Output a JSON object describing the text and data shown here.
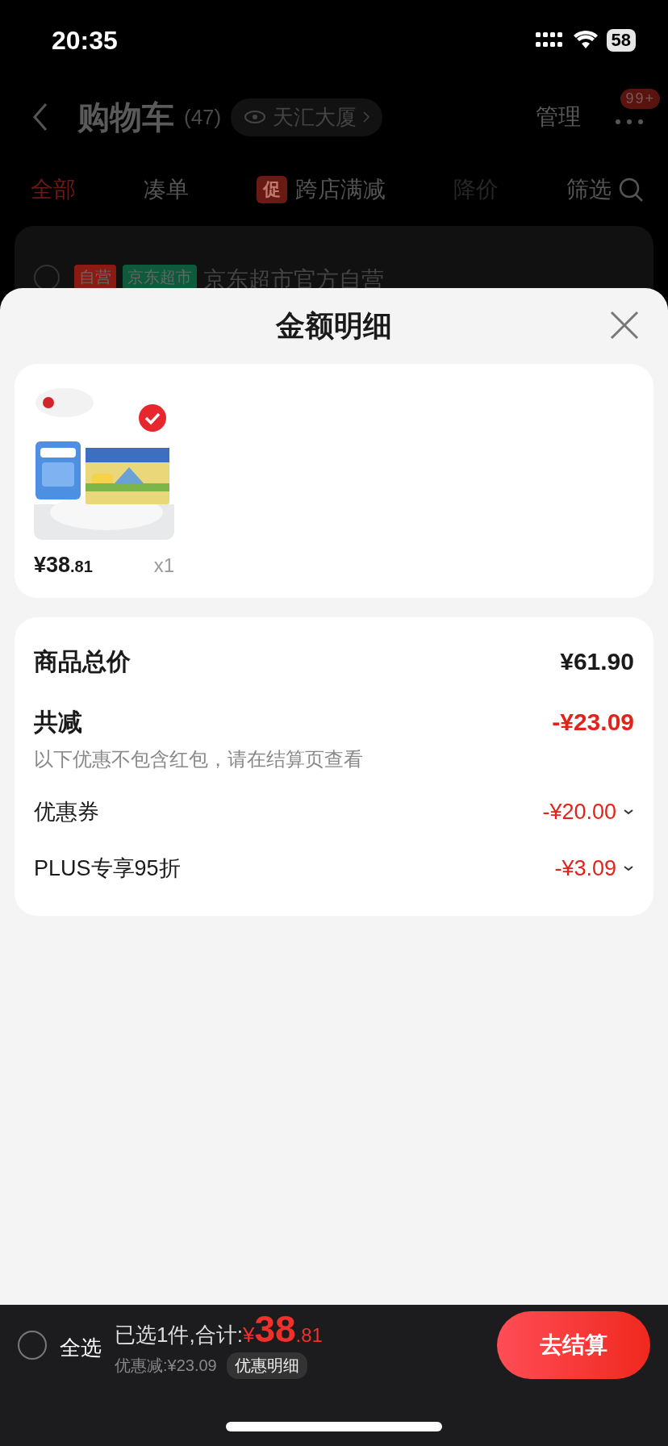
{
  "status_bar": {
    "time": "20:35",
    "battery": "58"
  },
  "header": {
    "title": "购物车",
    "count": "(47)",
    "location": "天汇大厦",
    "manage": "管理",
    "badge": "99+"
  },
  "tabs": [
    {
      "label": "全部",
      "selected": true,
      "disabled": false
    },
    {
      "label": "凑单",
      "selected": false,
      "disabled": false
    },
    {
      "label": "跨店满减",
      "tag": "促",
      "selected": false,
      "disabled": false
    },
    {
      "label": "降价",
      "selected": false,
      "disabled": true
    }
  ],
  "filter": "筛选",
  "store": {
    "checked": false,
    "name": "京东超市官方自营",
    "tags": [
      {
        "label": "自营",
        "color": "#8a1a12"
      },
      {
        "label": "京东超市",
        "color": "#0d5a3c"
      }
    ]
  },
  "sheet": {
    "title": "金额明细",
    "product": {
      "kind": "picture",
      "checked": true,
      "price": "¥38",
      "price_cents": ".81",
      "quantity": "x1"
    },
    "summary": {
      "total_label": "商品总价",
      "total_value": "¥61.90",
      "discount_label": "共减",
      "discount_value": "-¥23.09",
      "note": "以下优惠不包含红包，请在结算页查看",
      "items": [
        {
          "label": "优惠券",
          "value": "-¥20.00",
          "expandable": true
        },
        {
          "label": "PLUS专享95折",
          "value": "-¥3.09",
          "expandable": true
        }
      ]
    }
  },
  "bottom_bar": {
    "select_all": {
      "label": "全选",
      "checked": false
    },
    "selected_text": "已选1件,合计:",
    "currency": "¥",
    "total": "38",
    "total_cents": ".81",
    "saved": "优惠减:¥23.09",
    "detail_button": "优惠明细",
    "checkout": "去结算"
  }
}
